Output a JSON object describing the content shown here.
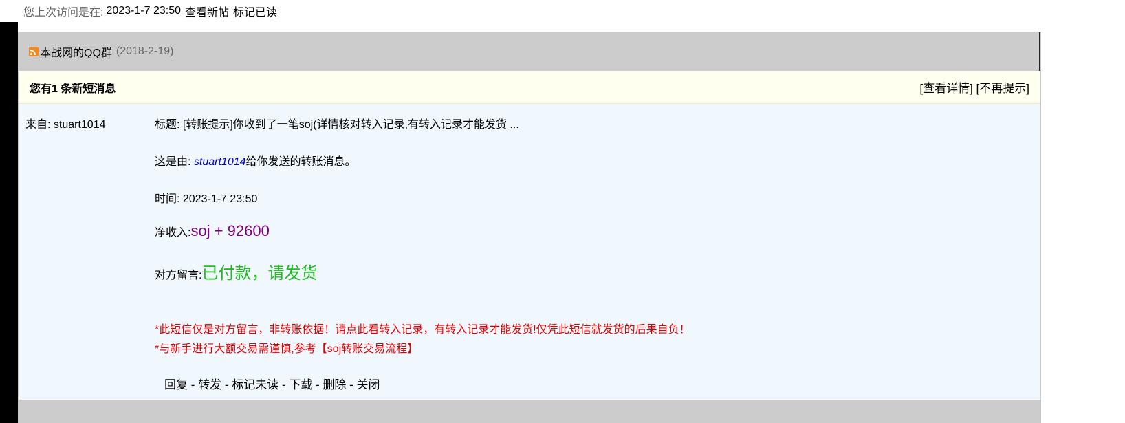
{
  "top": {
    "last_visit_label": "您上次访问是在:",
    "last_visit_time": "2023-1-7 23:50",
    "view_new_posts": "查看新帖",
    "mark_read": "标记已读"
  },
  "qq_group": {
    "icon": "rss-icon",
    "title": "本战网的QQ群",
    "date": "(2018-2-19)"
  },
  "message": {
    "header_title": "您有1 条新短消息",
    "view_details": "[查看详情]",
    "no_remind": "[不再提示]",
    "from_label": "来自: stuart1014",
    "subject": "标题: [转账提示]你收到了一笔soj(详情核对转入记录,有转入记录才能发货 ...",
    "sender_prefix": "这是由: ",
    "sender_name": "stuart1014",
    "sender_suffix": "给你发送的转账消息。",
    "time": "时间: 2023-1-7 23:50",
    "income_label": "净收入:",
    "income_amount": "soj + 92600",
    "note_label": "对方留言:",
    "note_text": "已付款，请发货",
    "warning1": "*此短信仅是对方留言，非转账依据！请点此看转入记录，有转入记录才能发货!仅凭此短信就发货的后果自负！",
    "warning2": "*与新手进行大额交易需谨慎,参考【soj转账交易流程】",
    "actions": {
      "reply": "回复",
      "forward": "转发",
      "mark_unread": "标记未读",
      "download": "下载",
      "delete": "删除",
      "close": "关闭",
      "separator": " - "
    }
  },
  "colors": {
    "income": "#800080",
    "note": "#22bb22",
    "warning": "#e00000",
    "sender_link": "#0000cc"
  }
}
